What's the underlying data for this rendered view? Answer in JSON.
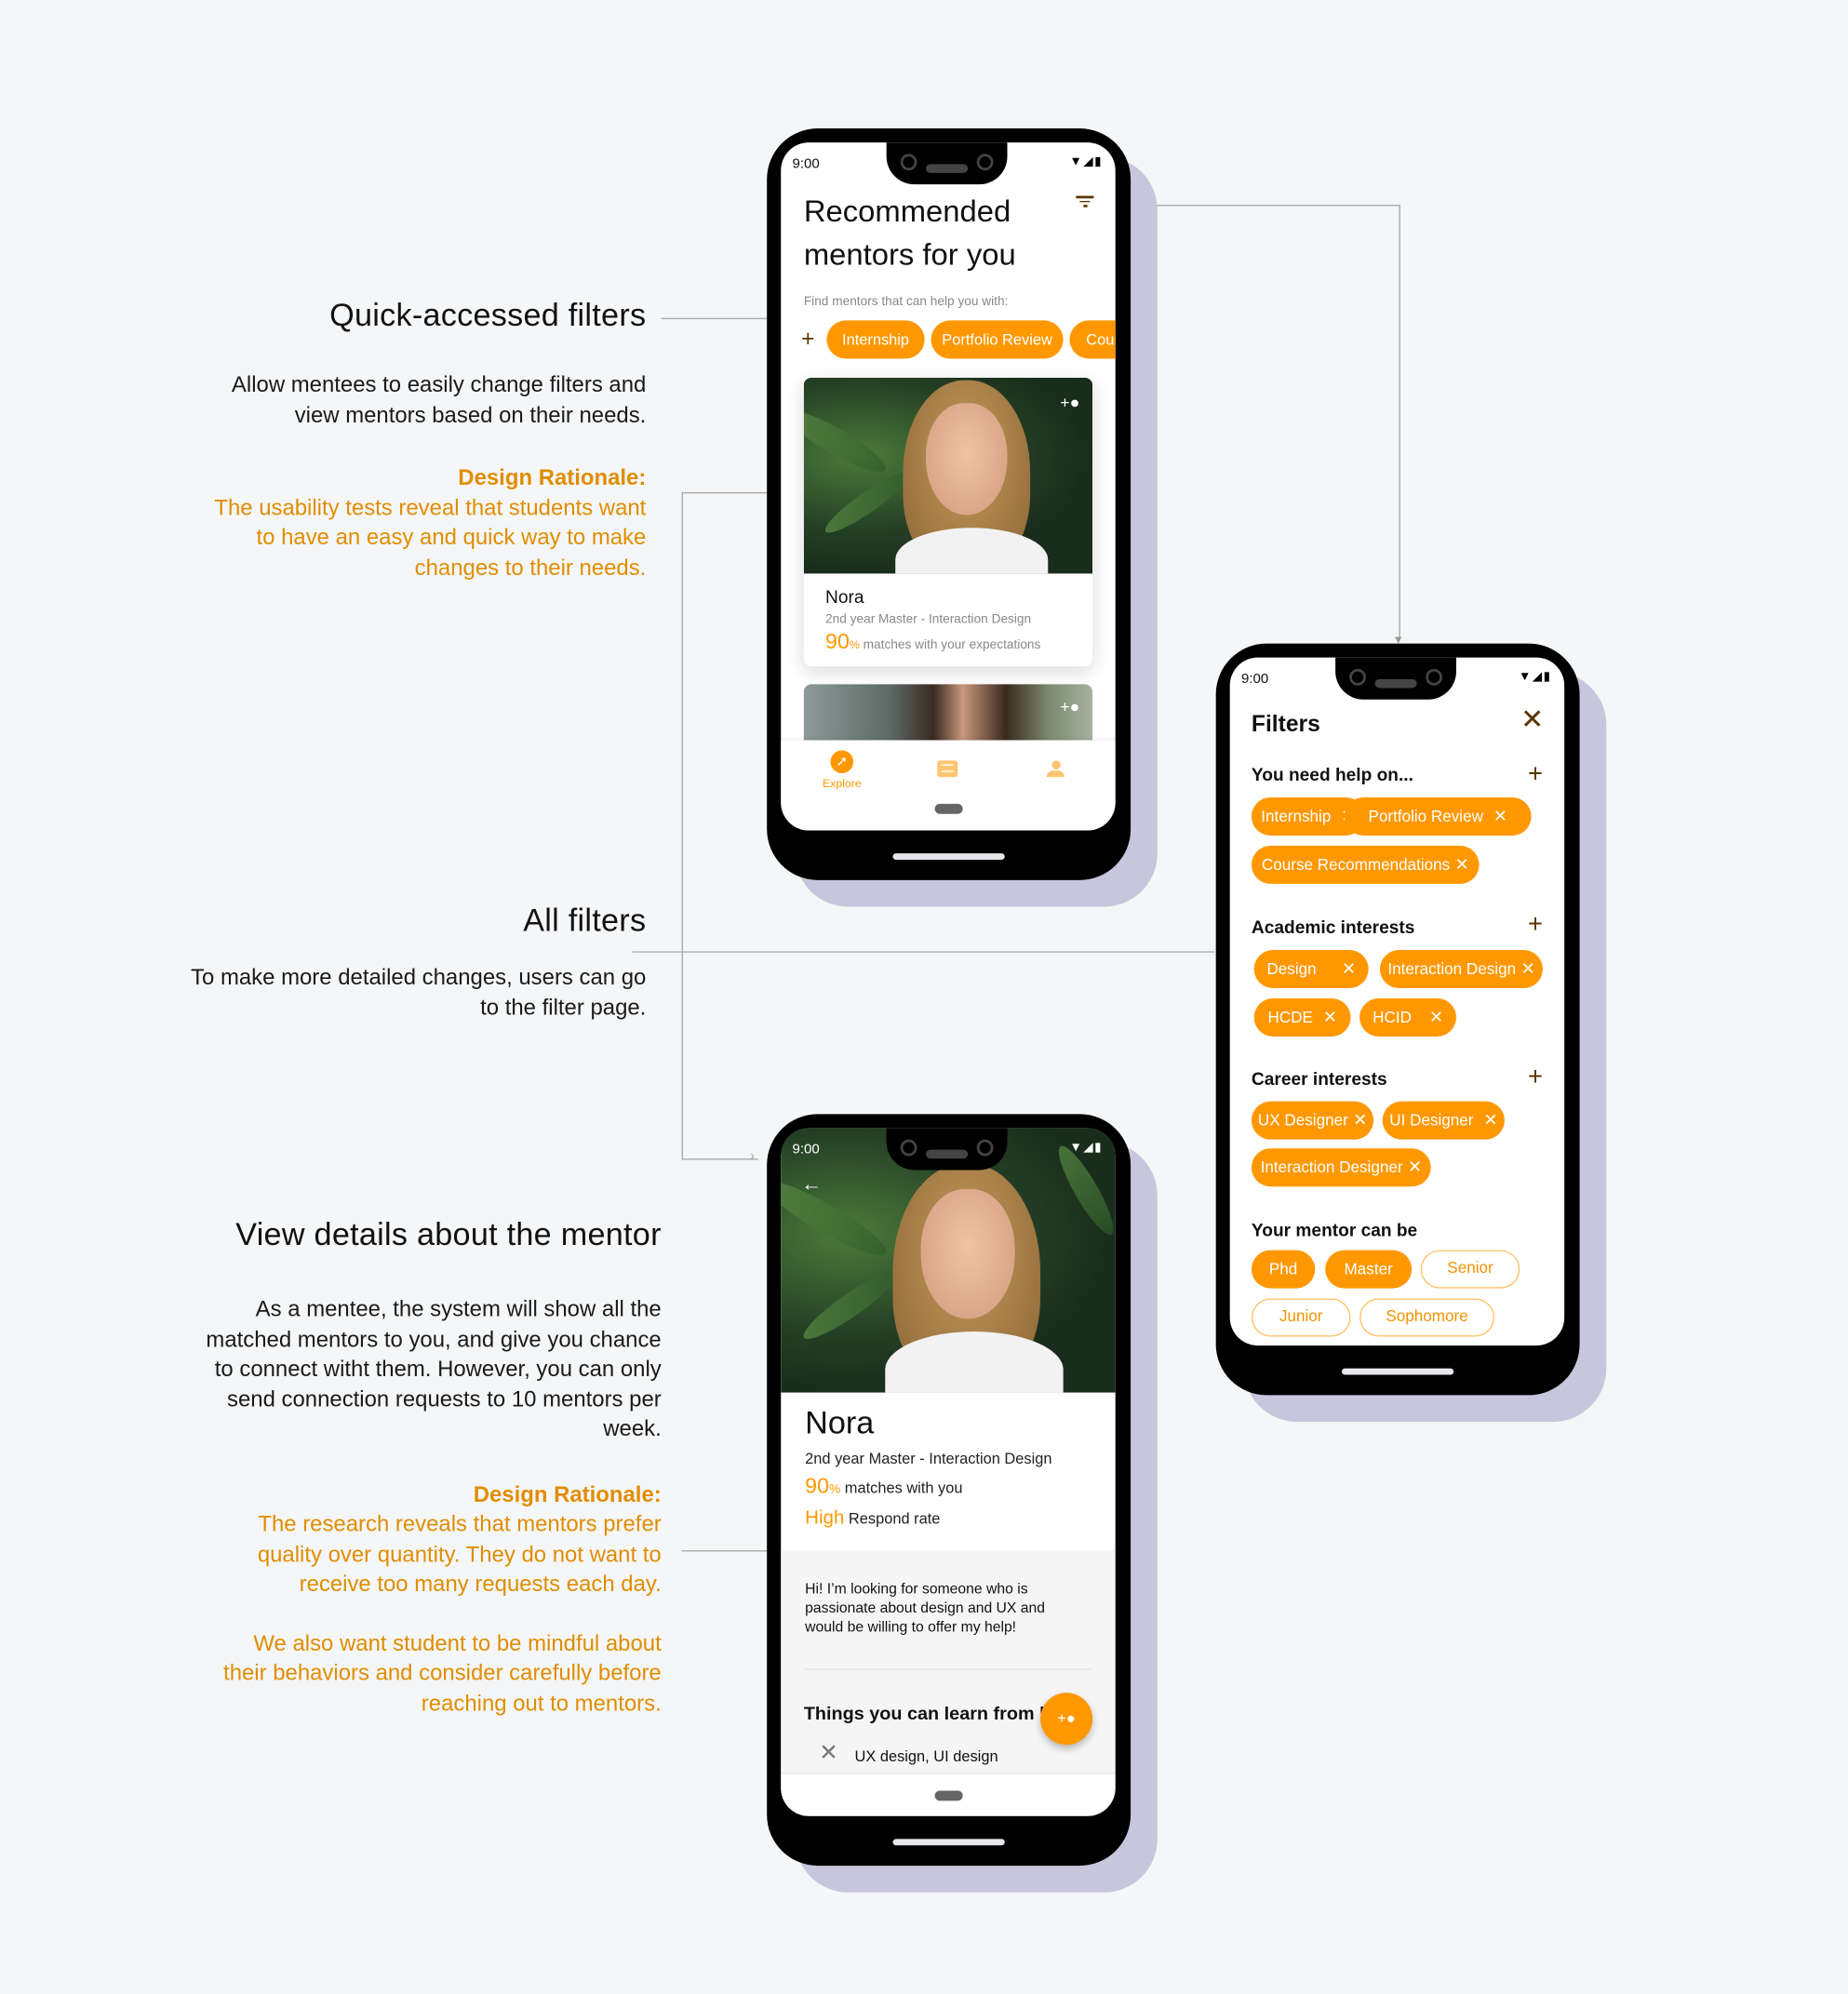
{
  "annotations": {
    "quick": {
      "title": "Quick-accessed filters",
      "body": [
        "Allow mentees to easily change filters and",
        "view mentors based on their needs."
      ],
      "rationale_label": "Design Rationale:",
      "rationale": [
        "The usability tests reveal that students want",
        "to have an easy and quick way to make",
        "changes to their needs."
      ]
    },
    "all": {
      "title": "All filters",
      "body": [
        "To make more detailed changes, users can go",
        "to the filter page."
      ]
    },
    "details": {
      "title": "View details about the mentor",
      "body": [
        "As a mentee, the system will show all the",
        "matched mentors to you, and give you chance",
        "to connect witht them. However, you can only",
        "send connection requests to 10 mentors per",
        "week."
      ],
      "rationale_label": "Design Rationale:",
      "rationale": [
        "The research reveals that mentors prefer",
        "quality over quantity. They do not want to",
        "receive too many requests each day."
      ],
      "rationale2": [
        "We also want student to be mindful about",
        "their behaviors and consider carefully before",
        "reaching out to mentors."
      ]
    }
  },
  "colors": {
    "accent": "#ff9800",
    "rationale": "#e08d00",
    "shadow": "#c8c6dc",
    "background": "#f5f6f8"
  },
  "status": {
    "time": "9:00",
    "icons": "wifi-icon signal-icon battery-icon"
  },
  "home": {
    "title_line1": "Recommended",
    "title_line2": "mentors for you",
    "subtitle": "Find mentors that can help you with:",
    "chips": [
      "Internship",
      "Portfolio Review",
      "Cour"
    ],
    "card": {
      "name": "Nora",
      "program": "2nd year Master - Interaction Design",
      "match_value": "90",
      "match_unit": "%",
      "match_text": "matches with your expectations"
    },
    "nav": [
      {
        "label": "Explore",
        "icon": "compass-icon"
      },
      {
        "label": "",
        "icon": "chat-icon"
      },
      {
        "label": "",
        "icon": "person-icon"
      }
    ]
  },
  "filters": {
    "title": "Filters",
    "sections": [
      {
        "title": "You need help on...",
        "chips": [
          "Internship",
          "Portfolio Review",
          "Course Recommendations"
        ]
      },
      {
        "title": "Academic interests",
        "chips": [
          "Design",
          "Interaction Design",
          "HCDE",
          "HCID"
        ]
      },
      {
        "title": "Career interests",
        "chips": [
          "UX Designer",
          "UI Designer",
          "Interaction Designer"
        ]
      },
      {
        "title": "Your mentor can be",
        "options": [
          {
            "label": "Phd",
            "selected": true
          },
          {
            "label": "Master",
            "selected": true
          },
          {
            "label": "Senior",
            "selected": false
          },
          {
            "label": "Junior",
            "selected": false
          },
          {
            "label": "Sophomore",
            "selected": false
          }
        ]
      }
    ]
  },
  "detail": {
    "name": "Nora",
    "program": "2nd year Master - Interaction Design",
    "match_value": "90",
    "match_unit": "%",
    "match_text": "matches with you",
    "rate_value": "High",
    "rate_text": "Respond rate",
    "bio": "Hi! I’m looking for someone who is passionate about design and UX and would be willing to offer my help!",
    "learn_title": "Things you can learn from h",
    "learn_item": "UX design, UI design"
  }
}
